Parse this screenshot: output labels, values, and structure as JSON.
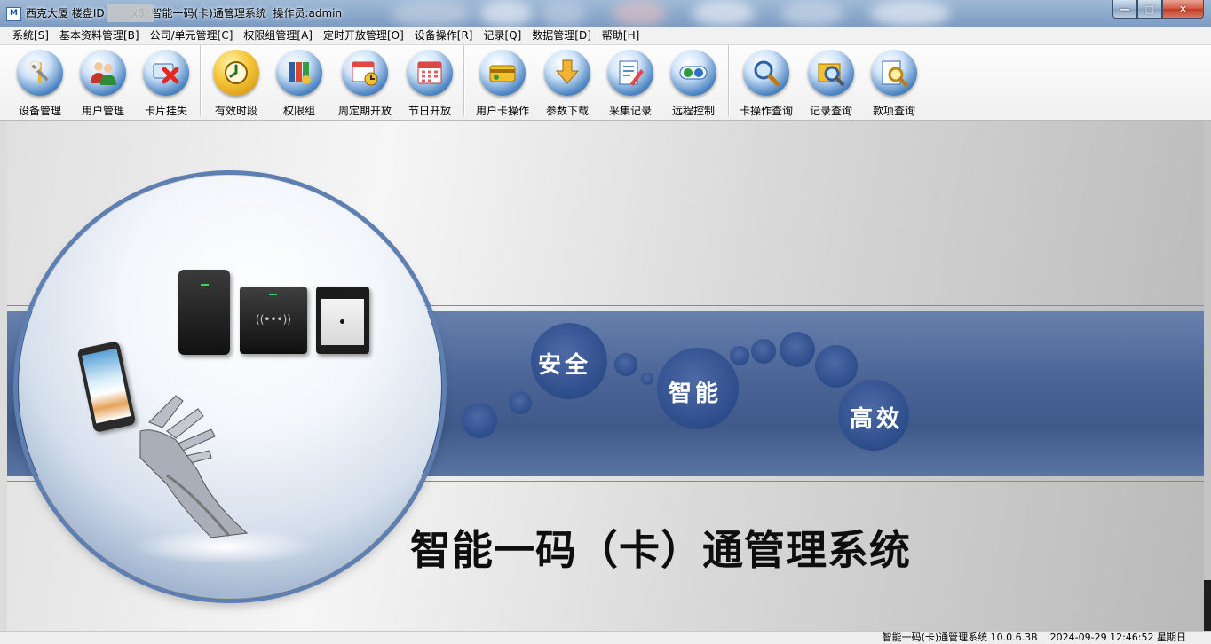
{
  "window": {
    "title": "西克大厦 楼盘ID        x8  智能一码(卡)通管理系统  操作员:admin",
    "minimize_glyph": "—",
    "maximize_glyph": "□",
    "close_glyph": "✕"
  },
  "menu": [
    {
      "label": "系统[S]"
    },
    {
      "label": "基本资料管理[B]"
    },
    {
      "label": "公司/单元管理[C]"
    },
    {
      "label": "权限组管理[A]"
    },
    {
      "label": "定时开放管理[O]"
    },
    {
      "label": "设备操作[R]"
    },
    {
      "label": "记录[Q]"
    },
    {
      "label": "数据管理[D]"
    },
    {
      "label": "帮助[H]"
    }
  ],
  "toolbar": [
    {
      "label": "设备管理",
      "icon": "tools-icon"
    },
    {
      "label": "用户管理",
      "icon": "users-icon"
    },
    {
      "label": "卡片挂失",
      "icon": "card-lost-icon"
    },
    {
      "label": "有效时段",
      "icon": "clock-icon"
    },
    {
      "label": "权限组",
      "icon": "permission-group-icon"
    },
    {
      "label": "周定期开放",
      "icon": "weekly-calendar-icon"
    },
    {
      "label": "节日开放",
      "icon": "holiday-calendar-icon"
    },
    {
      "label": "用户卡操作",
      "icon": "user-card-icon"
    },
    {
      "label": "参数下载",
      "icon": "download-icon"
    },
    {
      "label": "采集记录",
      "icon": "collect-record-icon"
    },
    {
      "label": "远程控制",
      "icon": "remote-control-icon"
    },
    {
      "label": "卡操作查询",
      "icon": "card-query-icon"
    },
    {
      "label": "记录查询",
      "icon": "record-query-icon"
    },
    {
      "label": "款项查询",
      "icon": "payment-query-icon"
    }
  ],
  "banner": {
    "words": [
      "安全",
      "智能",
      "高效"
    ],
    "slogan": "智能一码（卡）通管理系统",
    "reader_text": "((•••))"
  },
  "status": {
    "text": "智能一码(卡)通管理系统 10.0.6.3B    2024-09-29 12:46:52 星期日"
  },
  "colors": {
    "band": "#4b6597",
    "accent": "#5e7fb2"
  }
}
